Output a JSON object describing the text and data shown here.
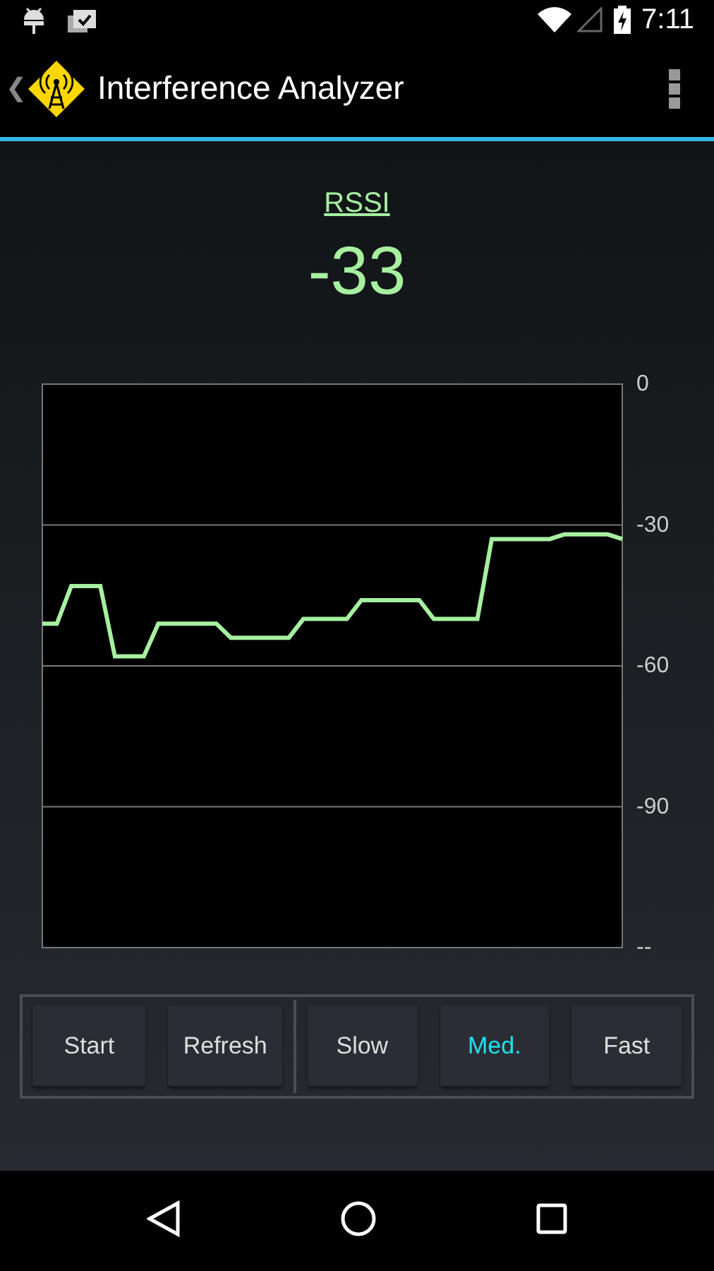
{
  "status_bar": {
    "time": "7:11"
  },
  "action_bar": {
    "back": "❮",
    "title": "Interference Analyzer"
  },
  "reading": {
    "label": "RSSI",
    "value": "-33"
  },
  "chart_data": {
    "type": "line",
    "categories": [
      null,
      null,
      null,
      null,
      null,
      null,
      null,
      null,
      null,
      null,
      null,
      null,
      null,
      null,
      null,
      null,
      null,
      null,
      null,
      null,
      null,
      null,
      null,
      null,
      null,
      null,
      null,
      null,
      null,
      null,
      null,
      null,
      null,
      null,
      null,
      null,
      null,
      null,
      null,
      null,
      null
    ],
    "series": [
      {
        "color": "#a6f0a0",
        "values": [
          -51,
          -51,
          -43,
          -43,
          -43,
          -58,
          -58,
          -58,
          -51,
          -51,
          -51,
          -51,
          -51,
          -54,
          -54,
          -54,
          -54,
          -54,
          -50,
          -50,
          -50,
          -50,
          -46,
          -46,
          -46,
          -46,
          -46,
          -50,
          -50,
          -50,
          -50,
          -33,
          -33,
          -33,
          -33,
          -33,
          -32,
          -32,
          -32,
          -32,
          -33
        ]
      }
    ],
    "grid": true,
    "ylim": [
      -120,
      0
    ],
    "yticks": [
      0,
      -30,
      -60,
      -90,
      {
        "value": -120,
        "label": "--"
      }
    ]
  },
  "button_groups": [
    [
      {
        "label": "Start",
        "selected": false
      },
      {
        "label": "Refresh",
        "selected": false
      }
    ],
    [
      {
        "label": "Slow",
        "selected": false
      },
      {
        "label": "Med.",
        "selected": true
      },
      {
        "label": "Fast",
        "selected": false
      }
    ]
  ]
}
